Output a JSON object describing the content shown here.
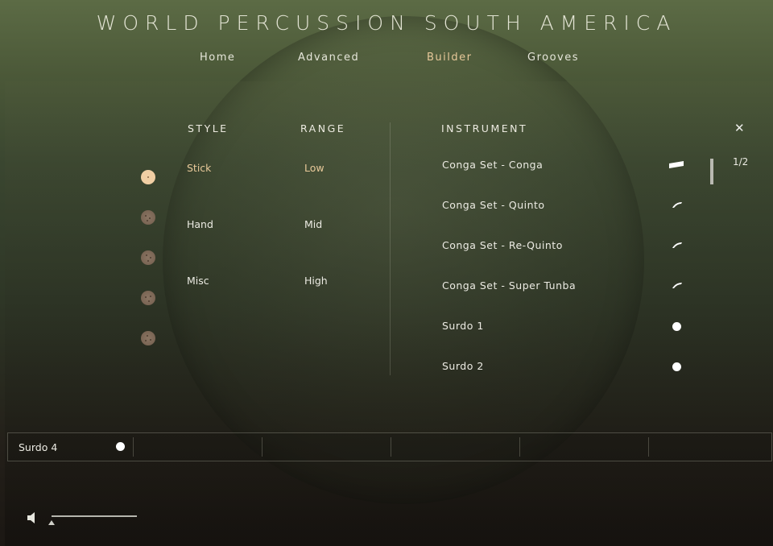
{
  "header": {
    "title": "WORLD PERCUSSION SOUTH AMERICA"
  },
  "nav": [
    {
      "label": "Home"
    },
    {
      "label": "Advanced"
    },
    {
      "label": "Builder",
      "active": true
    },
    {
      "label": "Grooves"
    }
  ],
  "style": {
    "heading": "STYLE",
    "options": [
      {
        "label": "Stick",
        "selected": true
      },
      {
        "label": "Hand"
      },
      {
        "label": "Misc"
      }
    ]
  },
  "range": {
    "heading": "RANGE",
    "options": [
      {
        "label": "Low",
        "selected": true
      },
      {
        "label": "Mid"
      },
      {
        "label": "High"
      }
    ]
  },
  "instrument": {
    "heading": "INSTRUMENT",
    "items": [
      {
        "label": "Conga Set - Conga",
        "icon": "stick-icon-wide"
      },
      {
        "label": "Conga Set - Quinto",
        "icon": "stick-icon"
      },
      {
        "label": "Conga Set - Re-Quinto",
        "icon": "stick-icon"
      },
      {
        "label": "Conga Set - Super Tunba",
        "icon": "stick-icon"
      },
      {
        "label": "Surdo 1",
        "icon": "dot-icon"
      },
      {
        "label": "Surdo 2",
        "icon": "dot-icon"
      }
    ],
    "page": "1/2",
    "close_glyph": "✕"
  },
  "slots": {
    "first_label": "Surdo 4",
    "count": 6
  },
  "volume": {
    "level": 1.0
  },
  "colors": {
    "accent": "#e8c99a",
    "text": "#ecebe3",
    "dot_active": "#f1cfa4",
    "dot": "#7a6554"
  }
}
